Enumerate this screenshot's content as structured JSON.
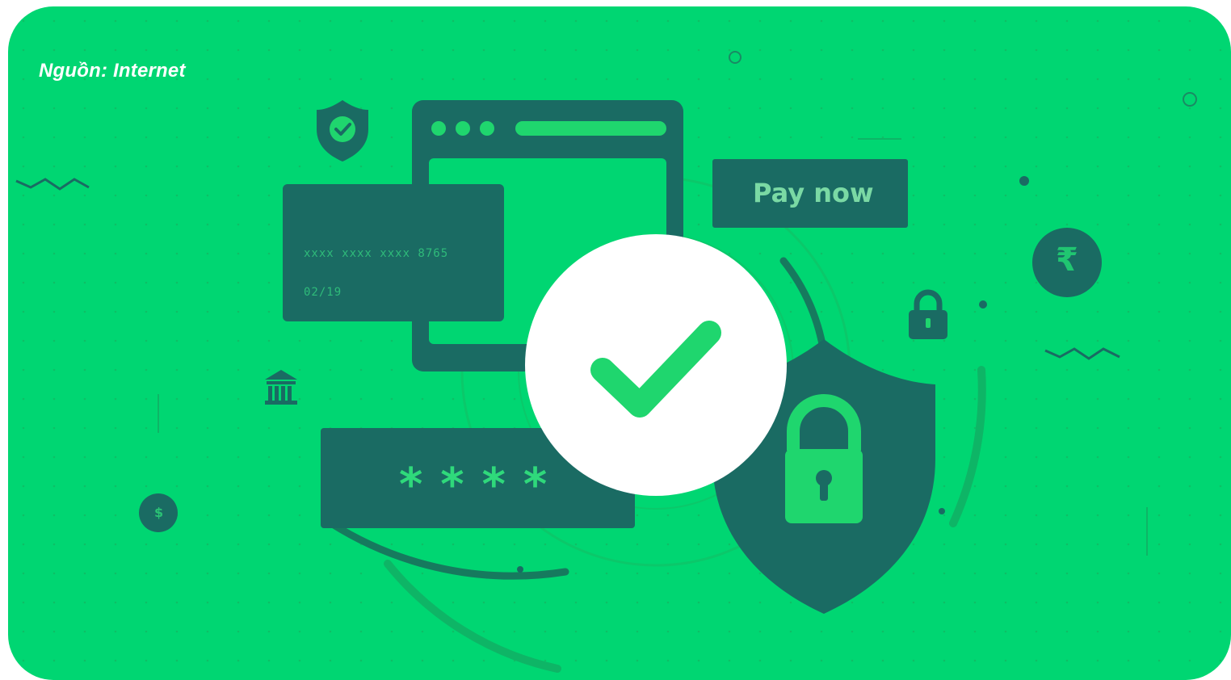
{
  "caption": "Nguồn: Internet",
  "illustration": {
    "pay_button": "Pay now",
    "card_number": "xxxx  xxxx  xxxx  8765",
    "card_expiry": "02/19",
    "password_mask": "****",
    "currency_symbol": "₹",
    "coin_symbol": "$",
    "icons": [
      "shield-check-icon",
      "browser-window-icon",
      "credit-card-icon",
      "check-circle-icon",
      "security-shield-lock-icon",
      "padlock-icon",
      "bank-icon",
      "rupee-coin-icon",
      "dollar-coin-icon"
    ],
    "colors": {
      "background": "#00d672",
      "dark": "#1a6b63",
      "check": "#1fd66e",
      "white": "#ffffff"
    }
  }
}
